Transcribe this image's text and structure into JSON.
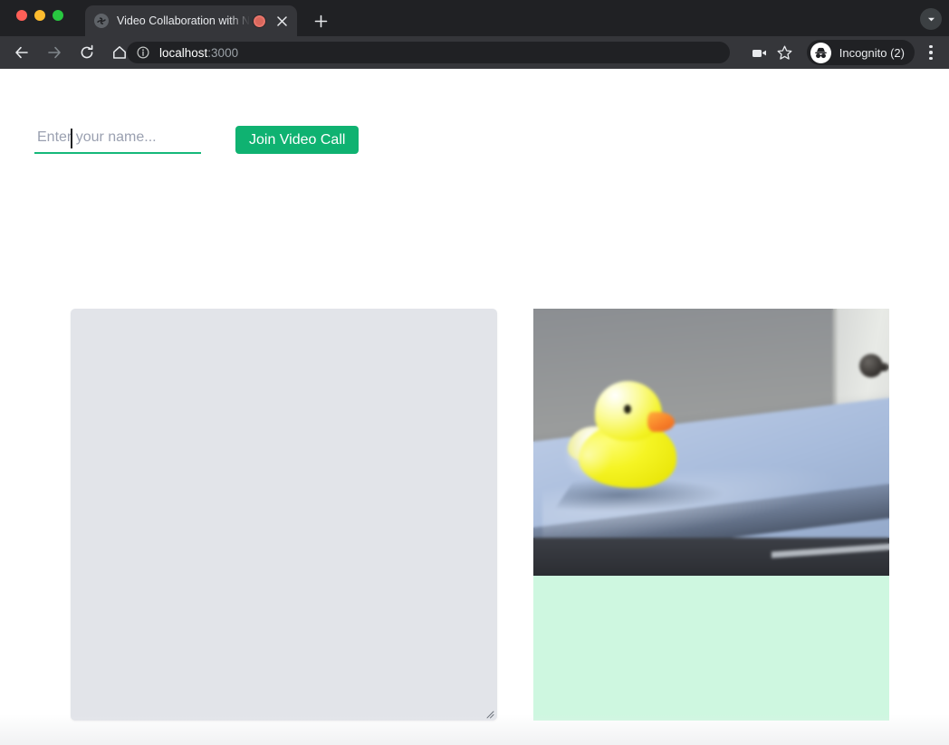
{
  "browser": {
    "window_controls": [
      "close",
      "minimize",
      "maximize"
    ],
    "tab": {
      "title": "Video Collaboration with Node",
      "favicon_name": "globe-favicon",
      "recording_indicator": "recording-dot",
      "close_label": "×"
    },
    "new_tab_label": "+",
    "tab_search_label": "▾",
    "toolbar": {
      "back_label": "←",
      "forward_label": "→",
      "reload_label": "↻",
      "home_label": "⌂",
      "url_host": "localhost",
      "url_port": ":3000",
      "info_icon": "site-info-icon",
      "media_icon": "camera-icon",
      "bookmark_icon": "star-icon",
      "profile_label": "Incognito (2)",
      "profile_icon": "incognito-icon",
      "menu_icon": "three-dot-menu-icon"
    }
  },
  "page": {
    "join_form": {
      "name_placeholder": "Enter your name...",
      "name_value": "",
      "join_button_label": "Join Video Call"
    },
    "media": {
      "local_panel_name": "local-video-placeholder",
      "local_panel_color": "#e2e4e9",
      "remote_video_name": "remote-video-stream",
      "remote_video_description": "Webcam feed showing a yellow rubber duck resting on a blue bed surface with a door in the background",
      "caption_panel_color": "#cef7e0"
    }
  },
  "colors": {
    "accent_green": "#0fb271",
    "input_underline": "#15b87a",
    "chrome_dark": "#202124",
    "toolbar_dark": "#35363a",
    "panel_gray": "#e2e4e9",
    "mint": "#cef7e0",
    "recording_red": "#d9675c"
  }
}
